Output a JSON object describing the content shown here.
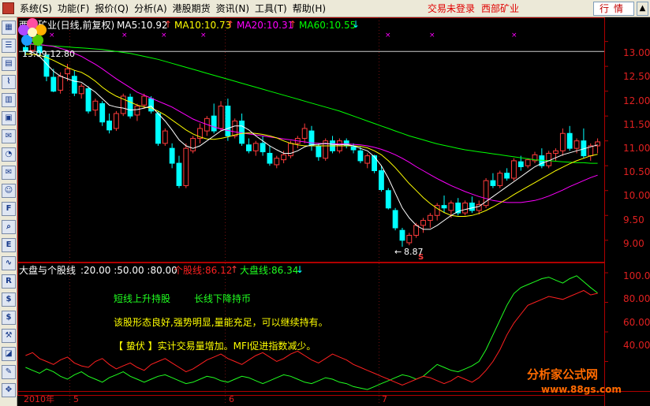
{
  "menu": {
    "items": [
      "系统(S)",
      "功能(F)",
      "报价(Q)",
      "分析(A)",
      "港股期货",
      "资讯(N)",
      "工具(T)",
      "帮助(H)"
    ],
    "login_status": "交易未登录",
    "stock_name": "西部矿业",
    "quote_button": "行情"
  },
  "toolbar": {
    "icons": [
      "grid-icon",
      "list-icon",
      "table-icon",
      "line-chart-icon",
      "bar-chart-icon",
      "report-icon",
      "news-icon",
      "pie-icon",
      "mail-icon",
      "people-icon",
      "f10-icon",
      "search-icon",
      "eit-icon",
      "wave-icon",
      "rsi-icon",
      "money-icon",
      "dollar-icon",
      "tools-icon",
      "tag-icon",
      "pen-icon",
      "move-icon"
    ]
  },
  "header": {
    "title": "西部矿业(日线,前复权)",
    "ma5": "MA5:10.92",
    "ma10": "MA10:10.73",
    "ma20": "MA20:10.31",
    "ma60": "MA60:10.55"
  },
  "price_axis": [
    "13.00",
    "12.50",
    "12.00",
    "11.50",
    "11.00",
    "10.50",
    "10.00",
    "9.50",
    "9.00"
  ],
  "high_marker": "13.09-12.80",
  "low_marker": "8.87",
  "indicator_header": {
    "title": "大盘与个股线",
    "params": ":20.00 :50.00 :80.00",
    "stock_line": "个股线:86.12",
    "market_line": "大盘线:86.34"
  },
  "indicator_axis": [
    "100.00",
    "80.00",
    "60.00",
    "40.00"
  ],
  "signals": {
    "short_term": "短线上升持股",
    "long_term": "长线下降持币",
    "comment": "该股形态良好,强势明显,量能充足，可以继续持有。",
    "ambush": "【 蛰伏 】实计交易量增加。MFI促进指数减少。"
  },
  "x_axis": [
    "2010年",
    "5",
    "6",
    "7"
  ],
  "watermark": {
    "name": "分析家公式网",
    "url": "www.88gs.com"
  },
  "colors": {
    "up": "#ff3c3c",
    "down": "#00ffff",
    "ma5": "#ffffff",
    "ma10": "#ffff00",
    "ma20": "#ff00ff",
    "ma60": "#00ff00",
    "stock_line": "#ff2020",
    "market_line": "#20ff20"
  },
  "chart_data": {
    "type": "candlestick",
    "candles_ohlc": [
      [
        12.88,
        12.95,
        12.72,
        12.8
      ],
      [
        12.82,
        13.09,
        12.78,
        13.02
      ],
      [
        12.9,
        12.98,
        12.7,
        12.78
      ],
      [
        12.72,
        12.75,
        12.2,
        12.3
      ],
      [
        12.28,
        12.45,
        11.98,
        12.0
      ],
      [
        12.02,
        12.38,
        11.95,
        12.3
      ],
      [
        12.35,
        12.55,
        12.2,
        12.45
      ],
      [
        12.3,
        12.42,
        11.9,
        11.96
      ],
      [
        11.95,
        12.15,
        11.85,
        12.1
      ],
      [
        12.05,
        12.1,
        11.55,
        11.6
      ],
      [
        11.62,
        11.85,
        11.5,
        11.8
      ],
      [
        11.75,
        11.8,
        11.3,
        11.38
      ],
      [
        11.4,
        11.55,
        11.15,
        11.22
      ],
      [
        11.25,
        11.6,
        11.2,
        11.55
      ],
      [
        11.55,
        11.95,
        11.5,
        11.9
      ],
      [
        11.88,
        11.95,
        11.45,
        11.5
      ],
      [
        11.52,
        11.75,
        11.4,
        11.7
      ],
      [
        11.72,
        11.95,
        11.65,
        11.9
      ],
      [
        11.85,
        11.9,
        11.55,
        11.6
      ],
      [
        11.55,
        11.6,
        10.9,
        10.95
      ],
      [
        10.95,
        11.25,
        10.9,
        11.2
      ],
      [
        10.85,
        10.95,
        10.45,
        10.55
      ],
      [
        10.55,
        10.7,
        10.05,
        10.1
      ],
      [
        10.1,
        10.95,
        10.05,
        10.85
      ],
      [
        10.8,
        11.1,
        10.75,
        11.05
      ],
      [
        11.05,
        11.35,
        10.95,
        11.25
      ],
      [
        11.2,
        11.5,
        11.1,
        11.45
      ],
      [
        11.5,
        11.75,
        11.15,
        11.2
      ],
      [
        11.25,
        11.8,
        11.2,
        11.7
      ],
      [
        11.7,
        11.85,
        11.0,
        11.1
      ],
      [
        11.1,
        11.45,
        11.05,
        11.4
      ],
      [
        11.4,
        11.55,
        10.9,
        10.95
      ],
      [
        10.92,
        11.05,
        10.75,
        10.8
      ],
      [
        10.8,
        11.0,
        10.7,
        10.95
      ],
      [
        10.95,
        11.1,
        10.7,
        10.78
      ],
      [
        10.75,
        10.9,
        10.5,
        10.55
      ],
      [
        10.52,
        10.7,
        10.45,
        10.65
      ],
      [
        10.62,
        10.8,
        10.55,
        10.72
      ],
      [
        10.7,
        11.0,
        10.65,
        10.95
      ],
      [
        10.95,
        11.1,
        10.85,
        11.05
      ],
      [
        11.05,
        11.35,
        10.95,
        11.25
      ],
      [
        11.2,
        11.3,
        10.8,
        10.9
      ],
      [
        10.9,
        10.95,
        10.6,
        10.68
      ],
      [
        10.65,
        11.05,
        10.6,
        11.0
      ],
      [
        11.0,
        11.1,
        10.75,
        10.8
      ],
      [
        10.8,
        11.05,
        10.75,
        11.0
      ],
      [
        11.0,
        11.05,
        10.85,
        10.9
      ],
      [
        10.88,
        10.95,
        10.75,
        10.82
      ],
      [
        10.8,
        10.88,
        10.55,
        10.6
      ],
      [
        10.55,
        10.75,
        10.45,
        10.7
      ],
      [
        10.7,
        10.72,
        10.35,
        10.4
      ],
      [
        10.4,
        10.5,
        9.98,
        10.02
      ],
      [
        10.0,
        10.05,
        9.62,
        9.65
      ],
      [
        9.6,
        9.65,
        9.2,
        9.25
      ],
      [
        9.2,
        9.25,
        8.87,
        9.0
      ],
      [
        8.95,
        9.15,
        8.9,
        9.1
      ],
      [
        9.1,
        9.35,
        9.05,
        9.3
      ],
      [
        9.3,
        9.45,
        9.15,
        9.4
      ],
      [
        9.4,
        9.55,
        9.25,
        9.5
      ],
      [
        9.5,
        9.75,
        9.4,
        9.7
      ],
      [
        9.7,
        9.9,
        9.55,
        9.65
      ],
      [
        9.6,
        9.8,
        9.45,
        9.75
      ],
      [
        9.75,
        9.85,
        9.5,
        9.55
      ],
      [
        9.55,
        9.8,
        9.5,
        9.75
      ],
      [
        9.75,
        9.88,
        9.55,
        9.6
      ],
      [
        9.6,
        9.8,
        9.52,
        9.72
      ],
      [
        9.7,
        10.25,
        9.65,
        10.2
      ],
      [
        10.2,
        10.35,
        10.05,
        10.1
      ],
      [
        10.1,
        10.4,
        10.05,
        10.35
      ],
      [
        10.35,
        10.45,
        10.2,
        10.25
      ],
      [
        10.25,
        10.65,
        10.2,
        10.6
      ],
      [
        10.58,
        10.7,
        10.4,
        10.48
      ],
      [
        10.5,
        10.65,
        10.45,
        10.62
      ],
      [
        10.6,
        10.78,
        10.55,
        10.72
      ],
      [
        10.7,
        10.85,
        10.45,
        10.5
      ],
      [
        10.5,
        10.8,
        10.45,
        10.75
      ],
      [
        10.75,
        10.85,
        10.6,
        10.8
      ],
      [
        10.8,
        11.25,
        10.7,
        11.15
      ],
      [
        11.15,
        11.3,
        10.8,
        10.85
      ],
      [
        10.85,
        11.05,
        10.75,
        11.0
      ],
      [
        11.0,
        11.25,
        10.65,
        10.7
      ],
      [
        10.7,
        10.95,
        10.6,
        10.9
      ],
      [
        10.9,
        11.05,
        10.75,
        10.98
      ]
    ],
    "ma5": [
      12.82,
      12.78,
      12.7,
      12.55,
      12.4,
      12.3,
      12.25,
      12.2,
      12.18,
      12.08,
      11.98,
      11.85,
      11.72,
      11.68,
      11.66,
      11.62,
      11.63,
      11.66,
      11.7,
      11.55,
      11.4,
      11.22,
      11.02,
      10.9,
      10.85,
      10.9,
      11.0,
      11.1,
      11.2,
      11.25,
      11.3,
      11.3,
      11.22,
      11.1,
      11.0,
      10.9,
      10.82,
      10.75,
      10.75,
      10.8,
      10.88,
      10.92,
      10.93,
      10.95,
      10.93,
      10.92,
      10.93,
      10.9,
      10.85,
      10.8,
      10.68,
      10.5,
      10.25,
      9.95,
      9.65,
      9.45,
      9.3,
      9.22,
      9.22,
      9.3,
      9.4,
      9.5,
      9.58,
      9.62,
      9.65,
      9.68,
      9.78,
      9.88,
      9.98,
      10.08,
      10.18,
      10.28,
      10.38,
      10.48,
      10.55,
      10.6,
      10.66,
      10.72,
      10.76,
      10.8,
      10.84,
      10.88,
      10.92
    ],
    "ma10": [
      12.75,
      12.74,
      12.72,
      12.68,
      12.62,
      12.55,
      12.48,
      12.42,
      12.38,
      12.3,
      12.2,
      12.08,
      11.98,
      11.9,
      11.84,
      11.78,
      11.72,
      11.68,
      11.66,
      11.6,
      11.52,
      11.42,
      11.32,
      11.22,
      11.14,
      11.08,
      11.04,
      11.03,
      11.05,
      11.08,
      11.12,
      11.15,
      11.16,
      11.15,
      11.13,
      11.1,
      11.06,
      11.0,
      10.95,
      10.92,
      10.9,
      10.9,
      10.9,
      10.9,
      10.9,
      10.9,
      10.9,
      10.9,
      10.89,
      10.86,
      10.8,
      10.72,
      10.6,
      10.46,
      10.3,
      10.14,
      10.0,
      9.86,
      9.74,
      9.64,
      9.56,
      9.5,
      9.48,
      9.48,
      9.5,
      9.54,
      9.6,
      9.67,
      9.75,
      9.83,
      9.92,
      10.0,
      10.08,
      10.16,
      10.24,
      10.32,
      10.4,
      10.47,
      10.54,
      10.6,
      10.65,
      10.7,
      10.73
    ],
    "ma20": [
      12.95,
      12.95,
      12.94,
      12.92,
      12.9,
      12.86,
      12.82,
      12.76,
      12.7,
      12.62,
      12.54,
      12.45,
      12.35,
      12.25,
      12.16,
      12.07,
      11.98,
      11.92,
      11.86,
      11.8,
      11.74,
      11.68,
      11.6,
      11.52,
      11.44,
      11.38,
      11.33,
      11.28,
      11.24,
      11.21,
      11.18,
      11.16,
      11.14,
      11.12,
      11.1,
      11.08,
      11.06,
      11.04,
      11.02,
      11.0,
      10.98,
      10.96,
      10.95,
      10.94,
      10.94,
      10.94,
      10.94,
      10.93,
      10.92,
      10.9,
      10.87,
      10.83,
      10.78,
      10.72,
      10.65,
      10.57,
      10.48,
      10.4,
      10.32,
      10.24,
      10.17,
      10.1,
      10.04,
      9.98,
      9.93,
      9.88,
      9.84,
      9.8,
      9.78,
      9.76,
      9.76,
      9.76,
      9.78,
      9.8,
      9.84,
      9.89,
      9.95,
      10.01,
      10.08,
      10.14,
      10.2,
      10.26,
      10.31
    ],
    "ma60": [
      12.95,
      12.94,
      12.93,
      12.92,
      12.91,
      12.9,
      12.89,
      12.88,
      12.87,
      12.86,
      12.85,
      12.84,
      12.82,
      12.8,
      12.78,
      12.76,
      12.73,
      12.7,
      12.67,
      12.64,
      12.6,
      12.56,
      12.52,
      12.48,
      12.44,
      12.4,
      12.36,
      12.32,
      12.28,
      12.24,
      12.2,
      12.16,
      12.12,
      12.08,
      12.04,
      12.0,
      11.96,
      11.92,
      11.88,
      11.84,
      11.8,
      11.76,
      11.72,
      11.68,
      11.64,
      11.6,
      11.55,
      11.5,
      11.45,
      11.4,
      11.35,
      11.3,
      11.25,
      11.2,
      11.15,
      11.1,
      11.06,
      11.02,
      10.98,
      10.94,
      10.91,
      10.88,
      10.85,
      10.82,
      10.8,
      10.78,
      10.76,
      10.74,
      10.72,
      10.7,
      10.68,
      10.66,
      10.64,
      10.62,
      10.61,
      10.6,
      10.59,
      10.58,
      10.57,
      10.56,
      10.56,
      10.55,
      10.55
    ],
    "indicator_stock": [
      44,
      46,
      42,
      40,
      38,
      41,
      43,
      39,
      37,
      36,
      40,
      42,
      38,
      35,
      37,
      39,
      36,
      34,
      38,
      40,
      42,
      39,
      36,
      33,
      35,
      38,
      41,
      43,
      45,
      42,
      40,
      38,
      41,
      44,
      46,
      43,
      40,
      42,
      45,
      47,
      44,
      41,
      39,
      42,
      45,
      43,
      41,
      38,
      36,
      34,
      32,
      30,
      28,
      26,
      24,
      26,
      28,
      30,
      29,
      27,
      25,
      27,
      30,
      28,
      26,
      29,
      34,
      40,
      48,
      58,
      66,
      72,
      78,
      80,
      82,
      84,
      83,
      82,
      84,
      86,
      88,
      85,
      86.12
    ],
    "indicator_market": [
      36,
      34,
      32,
      35,
      33,
      30,
      28,
      31,
      33,
      30,
      28,
      26,
      29,
      31,
      33,
      30,
      28,
      26,
      28,
      30,
      31,
      29,
      27,
      25,
      26,
      28,
      30,
      29,
      27,
      26,
      28,
      30,
      29,
      27,
      25,
      27,
      29,
      31,
      30,
      28,
      26,
      25,
      27,
      29,
      28,
      26,
      25,
      23,
      22,
      21,
      23,
      25,
      27,
      29,
      31,
      30,
      28,
      30,
      34,
      38,
      36,
      34,
      33,
      35,
      37,
      40,
      48,
      58,
      68,
      78,
      86,
      90,
      92,
      94,
      96,
      97,
      95,
      93,
      96,
      98,
      94,
      90,
      86.34
    ],
    "indicator_ylim": [
      20,
      100
    ],
    "price_ylim": [
      8.6,
      13.2
    ]
  }
}
